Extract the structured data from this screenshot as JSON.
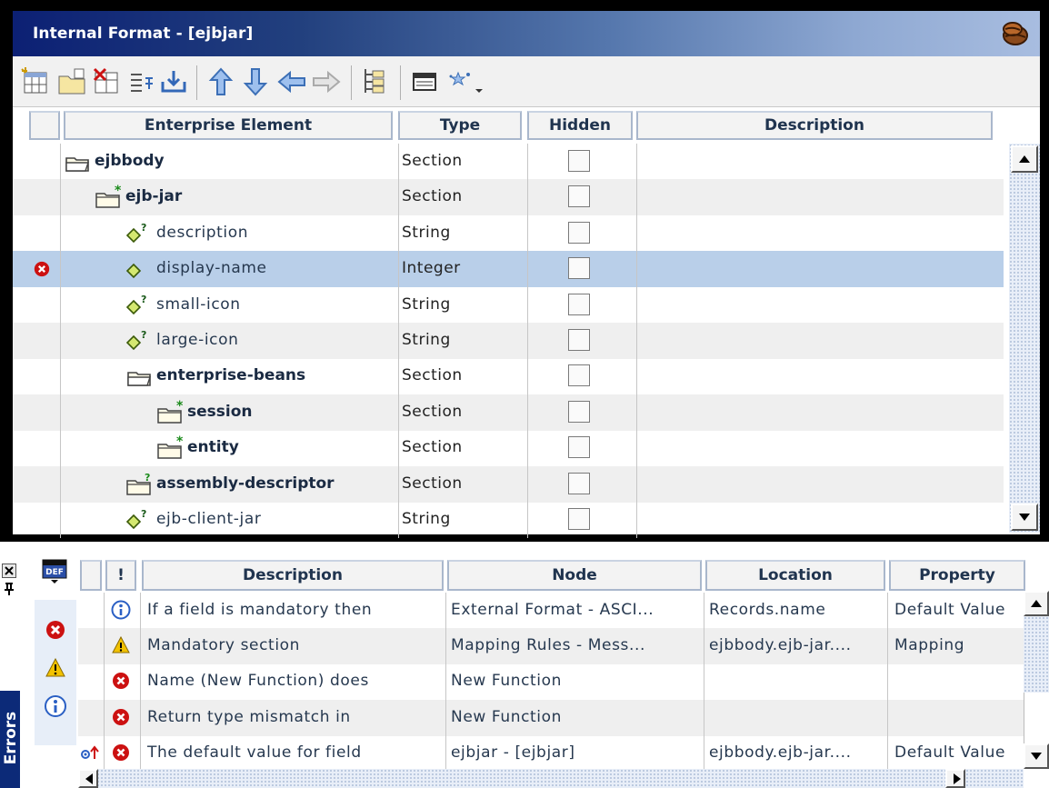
{
  "window": {
    "title": "Internal Format - [ejbjar]"
  },
  "toolbar": {
    "buttons": [
      "add-element-icon",
      "add-folder-icon",
      "delete-icon",
      "properties-icon",
      "import-icon",
      "move-up-icon",
      "move-down-icon",
      "move-left-icon",
      "move-right-icon",
      "tree-view-icon",
      "table-view-icon",
      "wizard-icon"
    ]
  },
  "grid": {
    "columns": {
      "element": "Enterprise Element",
      "type": "Type",
      "hidden": "Hidden",
      "description": "Description"
    },
    "rows": [
      {
        "name": "ejbbody",
        "type": "Section",
        "icon": "folder-open-icon",
        "style": "bold",
        "indent": 0,
        "error": false,
        "hidden": false
      },
      {
        "name": "ejb-jar",
        "type": "Section",
        "icon": "folder-star-icon",
        "style": "bold",
        "indent": 1,
        "error": false,
        "hidden": false
      },
      {
        "name": "description",
        "type": "String",
        "icon": "field-optional-icon",
        "style": "plain",
        "indent": 2,
        "error": false,
        "hidden": false
      },
      {
        "name": "display-name",
        "type": "Integer",
        "icon": "field-icon",
        "style": "plain",
        "indent": 2,
        "error": true,
        "hidden": false
      },
      {
        "name": "small-icon",
        "type": "String",
        "icon": "field-optional-icon",
        "style": "plain",
        "indent": 2,
        "error": false,
        "hidden": false
      },
      {
        "name": "large-icon",
        "type": "String",
        "icon": "field-optional-icon",
        "style": "plain",
        "indent": 2,
        "error": false,
        "hidden": false
      },
      {
        "name": "enterprise-beans",
        "type": "Section",
        "icon": "folder-open-icon",
        "style": "bold",
        "indent": 2,
        "error": false,
        "hidden": false
      },
      {
        "name": "session",
        "type": "Section",
        "icon": "folder-star-icon",
        "style": "bold",
        "indent": 3,
        "error": false,
        "hidden": false
      },
      {
        "name": "entity",
        "type": "Section",
        "icon": "folder-star-icon",
        "style": "bold",
        "indent": 3,
        "error": false,
        "hidden": false
      },
      {
        "name": "assembly-descriptor",
        "type": "Section",
        "icon": "folder-optional-icon",
        "style": "bold",
        "indent": 2,
        "error": false,
        "hidden": false
      },
      {
        "name": "ejb-client-jar",
        "type": "String",
        "icon": "field-optional-icon",
        "style": "plain",
        "indent": 2,
        "error": false,
        "hidden": false
      }
    ]
  },
  "errors": {
    "tab_label": "Errors",
    "columns": {
      "bang": "!",
      "description": "Description",
      "node": "Node",
      "location": "Location",
      "property": "Property"
    },
    "rows": [
      {
        "severity": "info-icon",
        "description": "If a field is mandatory then",
        "node": "External Format - ASCI...",
        "location": "Records.name",
        "property": "Default Value",
        "marker": ""
      },
      {
        "severity": "warning-icon",
        "description": "Mandatory section",
        "node": "Mapping Rules - Mess...",
        "location": "ejbbody.ejb-jar....",
        "property": "Mapping",
        "marker": ""
      },
      {
        "severity": "error-icon",
        "description": "Name (New Function) does",
        "node": "New Function",
        "location": "",
        "property": "",
        "marker": ""
      },
      {
        "severity": "error-icon",
        "description": "Return type mismatch in",
        "node": "New Function",
        "location": "",
        "property": "",
        "marker": ""
      },
      {
        "severity": "error-icon",
        "description": "The default value for field",
        "node": "ejbjar -  [ejbjar]",
        "location": "ejbbody.ejb-jar....",
        "property": "Default Value",
        "marker": "goto-icon"
      }
    ]
  },
  "colors": {
    "title_dark": "#0c2074",
    "title_light": "#a8bde0",
    "selection": "#b9cfe9",
    "error_red": "#cc1111",
    "warning_yellow": "#f2c200",
    "info_blue": "#2a5fc4"
  }
}
